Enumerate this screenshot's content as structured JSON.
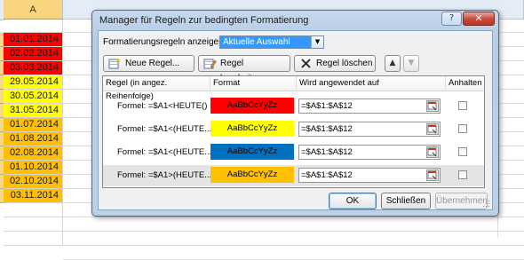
{
  "sheet": {
    "column_header": "A",
    "cells": [
      {
        "value": "01.01.2014",
        "color": "#ff0000"
      },
      {
        "value": "02.02.2014",
        "color": "#ff0000"
      },
      {
        "value": "03.03.2014",
        "color": "#ff0000"
      },
      {
        "value": "29.05.2014",
        "color": "#ffff00"
      },
      {
        "value": "30.05.2014",
        "color": "#ffff00"
      },
      {
        "value": "31.05.2014",
        "color": "#ffff00"
      },
      {
        "value": "01.07.2014",
        "color": "#ffc000"
      },
      {
        "value": "01.08.2014",
        "color": "#ffc000"
      },
      {
        "value": "02.08.2014",
        "color": "#ffc000"
      },
      {
        "value": "01.10.2014",
        "color": "#ffc000"
      },
      {
        "value": "02.10.2014",
        "color": "#ffc000"
      },
      {
        "value": "03.11.2014",
        "color": "#ffc000"
      }
    ]
  },
  "dialog": {
    "title": "Manager für Regeln zur bedingten Formatierung",
    "help": "?",
    "close": "✕",
    "show_rules_label": "Formatierungsregeln anzeigen für:",
    "show_rules_value": "Aktuelle Auswahl",
    "toolbar": {
      "new_rule": "Neue Regel...",
      "edit_rule": "Regel bearbeiten...",
      "delete_rule": "Regel löschen",
      "move_up": "▲",
      "move_down": "▼"
    },
    "columns": {
      "rule": "Regel (in angez. Reihenfolge)",
      "format": "Format",
      "applies_to": "Wird angewendet auf",
      "stop": "Anhalten"
    },
    "rules": [
      {
        "rule": "Formel: =$A1<HEUTE()",
        "preview": "AaBbCcYyZz",
        "color": "#ff0000",
        "applies_to": "=$A$1:$A$12",
        "stop": false
      },
      {
        "rule": "Formel: =$A1<(HEUTE...",
        "preview": "AaBbCcYyZz",
        "color": "#ffff00",
        "applies_to": "=$A$1:$A$12",
        "stop": false
      },
      {
        "rule": "Formel: =$A1<(HEUTE...",
        "preview": "AaBbCcYyZz",
        "color": "#0070c0",
        "applies_to": "=$A$1:$A$12",
        "stop": false
      },
      {
        "rule": "Formel: =$A1>(HEUTE...",
        "preview": "AaBbCcYyZz",
        "color": "#ffc000",
        "applies_to": "=$A$1:$A$12",
        "stop": false
      }
    ],
    "buttons": {
      "ok": "OK",
      "close": "Schließen",
      "apply": "Übernehmen"
    }
  }
}
